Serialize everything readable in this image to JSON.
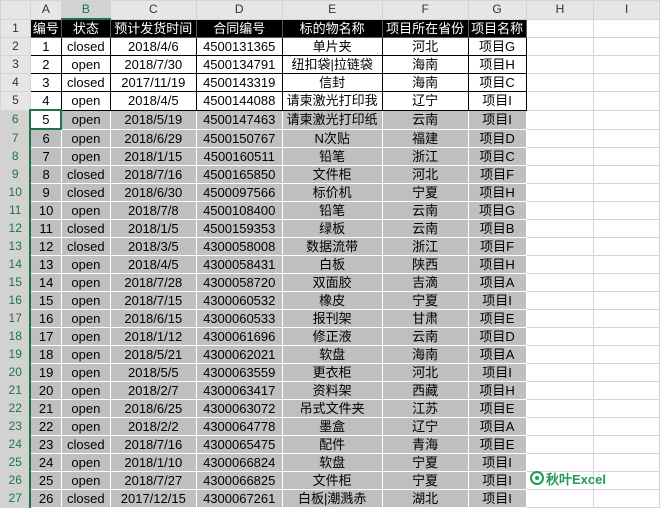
{
  "columns": [
    "A",
    "B",
    "C",
    "D",
    "E",
    "F",
    "G",
    "H",
    "I"
  ],
  "selected_column": "B",
  "header_row": [
    "编号",
    "状态",
    "预计发货时间",
    "合同编号",
    "标的物名称",
    "项目所在省份",
    "项目名称"
  ],
  "rows": [
    [
      "1",
      "closed",
      "2018/4/6",
      "4500131365",
      "单片夹",
      "河北",
      "项目G"
    ],
    [
      "2",
      "open",
      "2018/7/30",
      "4500134791",
      "纽扣袋|拉链袋",
      "海南",
      "项目H"
    ],
    [
      "3",
      "closed",
      "2017/11/19",
      "4500143319",
      "信封",
      "海南",
      "项目C"
    ],
    [
      "4",
      "open",
      "2018/4/5",
      "4500144088",
      "请柬激光打印我",
      "辽宁",
      "项目I"
    ],
    [
      "5",
      "open",
      "2018/5/19",
      "4500147463",
      "请柬激光打印纸",
      "云南",
      "项目I"
    ],
    [
      "6",
      "open",
      "2018/6/29",
      "4500150767",
      "N次贴",
      "福建",
      "项目D"
    ],
    [
      "7",
      "open",
      "2018/1/15",
      "4500160511",
      "铅笔",
      "浙江",
      "项目C"
    ],
    [
      "8",
      "closed",
      "2018/7/16",
      "4500165850",
      "文件柜",
      "河北",
      "项目F"
    ],
    [
      "9",
      "closed",
      "2018/6/30",
      "4500097566",
      "标价机",
      "宁夏",
      "项目H"
    ],
    [
      "10",
      "open",
      "2018/7/8",
      "4500108400",
      "铅笔",
      "云南",
      "项目G"
    ],
    [
      "11",
      "closed",
      "2018/1/5",
      "4500159353",
      "绿板",
      "云南",
      "项目B"
    ],
    [
      "12",
      "closed",
      "2018/3/5",
      "4300058008",
      "数据流带",
      "浙江",
      "项目F"
    ],
    [
      "13",
      "open",
      "2018/4/5",
      "4300058431",
      "白板",
      "陕西",
      "项目H"
    ],
    [
      "14",
      "open",
      "2018/7/28",
      "4300058720",
      "双面胶",
      "吉滴",
      "项目A"
    ],
    [
      "15",
      "open",
      "2018/7/15",
      "4300060532",
      "橡皮",
      "宁夏",
      "项目I"
    ],
    [
      "16",
      "open",
      "2018/6/15",
      "4300060533",
      "报刊架",
      "甘肃",
      "项目E"
    ],
    [
      "17",
      "open",
      "2018/1/12",
      "4300061696",
      "修正液",
      "云南",
      "项目D"
    ],
    [
      "18",
      "open",
      "2018/5/21",
      "4300062021",
      "软盘",
      "海南",
      "项目A"
    ],
    [
      "19",
      "open",
      "2018/5/5",
      "4300063559",
      "更衣柜",
      "河北",
      "项目I"
    ],
    [
      "20",
      "open",
      "2018/2/7",
      "4300063417",
      "资料架",
      "西藏",
      "项目H"
    ],
    [
      "21",
      "open",
      "2018/6/25",
      "4300063072",
      "吊式文件夹",
      "江苏",
      "项目E"
    ],
    [
      "22",
      "open",
      "2018/2/2",
      "4300064778",
      "墨盒",
      "辽宁",
      "项目A"
    ],
    [
      "23",
      "closed",
      "2018/7/16",
      "4300065475",
      "配件",
      "青海",
      "项目E"
    ],
    [
      "24",
      "open",
      "2018/1/10",
      "4300066824",
      "软盘",
      "宁夏",
      "项目I"
    ],
    [
      "25",
      "open",
      "2018/7/27",
      "4300066825",
      "文件柜",
      "宁夏",
      "项目I"
    ],
    [
      "26",
      "closed",
      "2017/12/15",
      "4300067261",
      "白板|潮溅赤",
      "湖北",
      "项目I"
    ]
  ],
  "logo_text": "秋叶Excel",
  "colors": {
    "header_bg": "#000000",
    "shade": "#bfbfbf",
    "accent": "#217346"
  }
}
